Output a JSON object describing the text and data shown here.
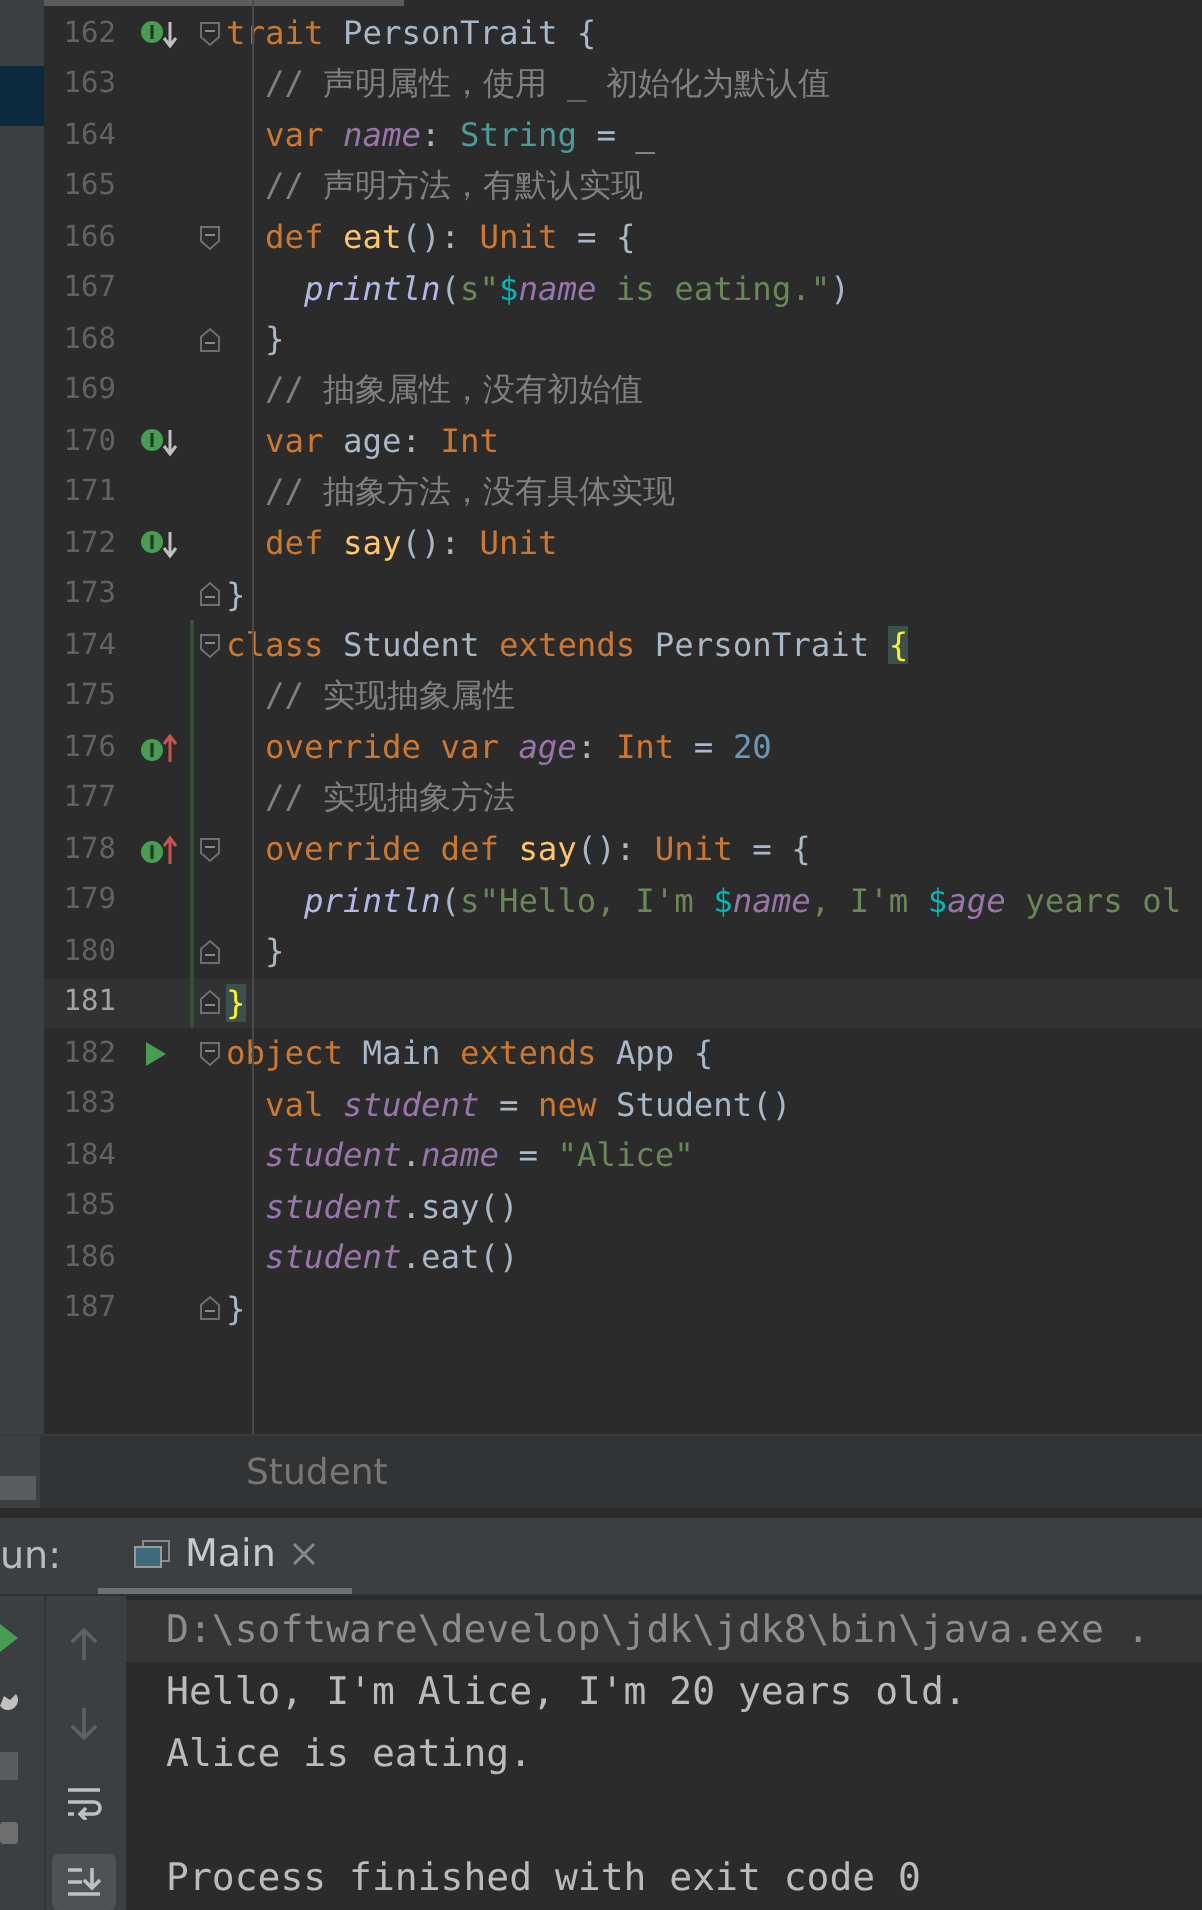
{
  "editor": {
    "lines": [
      {
        "number": "162",
        "marker": {
          "kind": "implemented"
        },
        "fold": {
          "kind": "start"
        },
        "current": false,
        "code": [
          {
            "kind": "kw",
            "text": "trait "
          },
          {
            "kind": "plain",
            "text": "PersonTrait {"
          }
        ]
      },
      {
        "number": "163",
        "current": false,
        "code": [
          {
            "kind": "comment",
            "text": "  // 声明属性，使用 _ 初始化为默认值"
          }
        ]
      },
      {
        "number": "164",
        "current": false,
        "code": [
          {
            "kind": "kw",
            "text": "  var "
          },
          {
            "kind": "field",
            "text": "name"
          },
          {
            "kind": "plain",
            "text": ": "
          },
          {
            "kind": "teal",
            "text": "String"
          },
          {
            "kind": "plain",
            "text": " = _"
          }
        ]
      },
      {
        "number": "165",
        "current": false,
        "code": [
          {
            "kind": "comment",
            "text": "  // 声明方法，有默认实现"
          }
        ]
      },
      {
        "number": "166",
        "fold": {
          "kind": "start"
        },
        "current": false,
        "code": [
          {
            "kind": "kw",
            "text": "  def "
          },
          {
            "kind": "fn",
            "text": "eat"
          },
          {
            "kind": "plain",
            "text": "(): "
          },
          {
            "kind": "kw",
            "text": "Unit"
          },
          {
            "kind": "plain",
            "text": " = {"
          }
        ]
      },
      {
        "number": "167",
        "current": false,
        "code": [
          {
            "kind": "call",
            "text": "    println"
          },
          {
            "kind": "plain",
            "text": "("
          },
          {
            "kind": "str",
            "text": "s\""
          },
          {
            "kind": "interp",
            "text": "$"
          },
          {
            "kind": "field",
            "text": "name"
          },
          {
            "kind": "str",
            "text": " is eating.\""
          },
          {
            "kind": "plain",
            "text": ")"
          }
        ]
      },
      {
        "number": "168",
        "fold": {
          "kind": "end"
        },
        "current": false,
        "code": [
          {
            "kind": "plain",
            "text": "  }"
          }
        ]
      },
      {
        "number": "169",
        "current": false,
        "code": [
          {
            "kind": "comment",
            "text": "  // 抽象属性，没有初始值"
          }
        ]
      },
      {
        "number": "170",
        "marker": {
          "kind": "implemented"
        },
        "current": false,
        "code": [
          {
            "kind": "kw",
            "text": "  var "
          },
          {
            "kind": "plain",
            "text": "age: "
          },
          {
            "kind": "kw",
            "text": "Int"
          }
        ]
      },
      {
        "number": "171",
        "current": false,
        "code": [
          {
            "kind": "comment",
            "text": "  // 抽象方法，没有具体实现"
          }
        ]
      },
      {
        "number": "172",
        "marker": {
          "kind": "implemented"
        },
        "current": false,
        "code": [
          {
            "kind": "kw",
            "text": "  def "
          },
          {
            "kind": "fn",
            "text": "say"
          },
          {
            "kind": "plain",
            "text": "(): "
          },
          {
            "kind": "kw",
            "text": "Unit"
          }
        ]
      },
      {
        "number": "173",
        "fold": {
          "kind": "end"
        },
        "current": false,
        "code": [
          {
            "kind": "plain",
            "text": "}"
          }
        ]
      },
      {
        "number": "174",
        "fold": {
          "kind": "start"
        },
        "current": false,
        "code": [
          {
            "kind": "kw",
            "text": "class "
          },
          {
            "kind": "plain",
            "text": "Student "
          },
          {
            "kind": "kw",
            "text": "extends "
          },
          {
            "kind": "plain",
            "text": "PersonTrait "
          },
          {
            "kind": "match",
            "text": "{"
          }
        ]
      },
      {
        "number": "175",
        "current": false,
        "code": [
          {
            "kind": "comment",
            "text": "  // 实现抽象属性"
          }
        ]
      },
      {
        "number": "176",
        "marker": {
          "kind": "overrides"
        },
        "current": false,
        "code": [
          {
            "kind": "kw",
            "text": "  override var "
          },
          {
            "kind": "field",
            "text": "age"
          },
          {
            "kind": "plain",
            "text": ": "
          },
          {
            "kind": "kw",
            "text": "Int"
          },
          {
            "kind": "plain",
            "text": " = "
          },
          {
            "kind": "num",
            "text": "20"
          }
        ]
      },
      {
        "number": "177",
        "current": false,
        "code": [
          {
            "kind": "comment",
            "text": "  // 实现抽象方法"
          }
        ]
      },
      {
        "number": "178",
        "marker": {
          "kind": "overrides"
        },
        "fold": {
          "kind": "start"
        },
        "current": false,
        "code": [
          {
            "kind": "kw",
            "text": "  override def "
          },
          {
            "kind": "fn",
            "text": "say"
          },
          {
            "kind": "plain",
            "text": "(): "
          },
          {
            "kind": "kw",
            "text": "Unit"
          },
          {
            "kind": "plain",
            "text": " = {"
          }
        ]
      },
      {
        "number": "179",
        "current": false,
        "code": [
          {
            "kind": "call",
            "text": "    println"
          },
          {
            "kind": "plain",
            "text": "("
          },
          {
            "kind": "str",
            "text": "s\"Hello, I'm "
          },
          {
            "kind": "interp",
            "text": "$"
          },
          {
            "kind": "field",
            "text": "name"
          },
          {
            "kind": "str",
            "text": ", I'm "
          },
          {
            "kind": "interp",
            "text": "$"
          },
          {
            "kind": "field",
            "text": "age"
          },
          {
            "kind": "str",
            "text": " years ol"
          }
        ]
      },
      {
        "number": "180",
        "fold": {
          "kind": "end"
        },
        "current": false,
        "code": [
          {
            "kind": "plain",
            "text": "  }"
          }
        ]
      },
      {
        "number": "181",
        "fold": {
          "kind": "end"
        },
        "current": true,
        "code": [
          {
            "kind": "match",
            "text": "}"
          }
        ]
      },
      {
        "number": "182",
        "marker": {
          "kind": "run"
        },
        "fold": {
          "kind": "start"
        },
        "current": false,
        "code": [
          {
            "kind": "kw",
            "text": "object "
          },
          {
            "kind": "plain",
            "text": "Main "
          },
          {
            "kind": "kw",
            "text": "extends "
          },
          {
            "kind": "plain",
            "text": "App {"
          }
        ]
      },
      {
        "number": "183",
        "current": false,
        "code": [
          {
            "kind": "kw",
            "text": "  val "
          },
          {
            "kind": "field",
            "text": "student"
          },
          {
            "kind": "plain",
            "text": " = "
          },
          {
            "kind": "kw",
            "text": "new "
          },
          {
            "kind": "plain",
            "text": "Student()"
          }
        ]
      },
      {
        "number": "184",
        "current": false,
        "code": [
          {
            "kind": "field",
            "text": "  student"
          },
          {
            "kind": "plain",
            "text": "."
          },
          {
            "kind": "field",
            "text": "name"
          },
          {
            "kind": "plain",
            "text": " = "
          },
          {
            "kind": "str",
            "text": "\"Alice\""
          }
        ]
      },
      {
        "number": "185",
        "current": false,
        "code": [
          {
            "kind": "field",
            "text": "  student"
          },
          {
            "kind": "plain",
            "text": ".say()"
          }
        ]
      },
      {
        "number": "186",
        "current": false,
        "code": [
          {
            "kind": "field",
            "text": "  student"
          },
          {
            "kind": "plain",
            "text": ".eat()"
          }
        ]
      },
      {
        "number": "187",
        "fold": {
          "kind": "end"
        },
        "current": false,
        "code": [
          {
            "kind": "plain",
            "text": "}"
          }
        ]
      }
    ]
  },
  "breadcrumb": "Student",
  "run_panel": {
    "label": "un:",
    "tabs": [
      {
        "label": "Main",
        "selected": true
      }
    ],
    "toolbar": [
      {
        "kind": "up",
        "on": false
      },
      {
        "kind": "down",
        "on": false
      },
      {
        "kind": "wrap",
        "on": false
      },
      {
        "kind": "scroll-end",
        "on": true
      }
    ],
    "console": [
      {
        "kind": "command",
        "text": "D:\\software\\develop\\jdk\\jdk8\\bin\\java.exe ."
      },
      {
        "kind": "output",
        "text": "Hello, I'm Alice, I'm 20 years old."
      },
      {
        "kind": "output",
        "text": "Alice is eating."
      },
      {
        "kind": "blank"
      },
      {
        "kind": "output",
        "text": "Process finished with exit code 0"
      }
    ]
  }
}
